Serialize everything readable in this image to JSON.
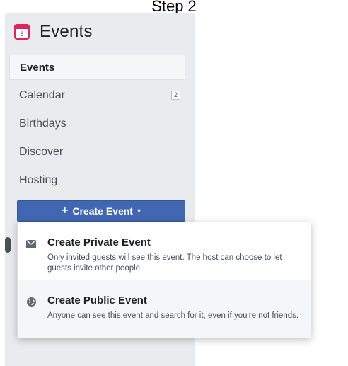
{
  "caption": "Step 2",
  "header": {
    "title": "Events",
    "calendar_day": "6"
  },
  "nav": {
    "items": [
      {
        "label": "Events",
        "active": true,
        "badge": ""
      },
      {
        "label": "Calendar",
        "active": false,
        "badge": "2"
      },
      {
        "label": "Birthdays",
        "active": false,
        "badge": ""
      },
      {
        "label": "Discover",
        "active": false,
        "badge": ""
      },
      {
        "label": "Hosting",
        "active": false,
        "badge": ""
      }
    ]
  },
  "create_button": {
    "plus": "+",
    "label": "Create Event",
    "caret": "▾"
  },
  "dropdown": {
    "private": {
      "title": "Create Private Event",
      "description": "Only invited guests will see this event. The host can choose to let guests invite other people."
    },
    "public": {
      "title": "Create Public Event",
      "description": "Anyone can see this event and search for it, even if you're not friends."
    }
  },
  "colors": {
    "accent": "#4267b2",
    "calendar_icon": "#e0245e",
    "sidebar_bg": "#e9ebee"
  }
}
